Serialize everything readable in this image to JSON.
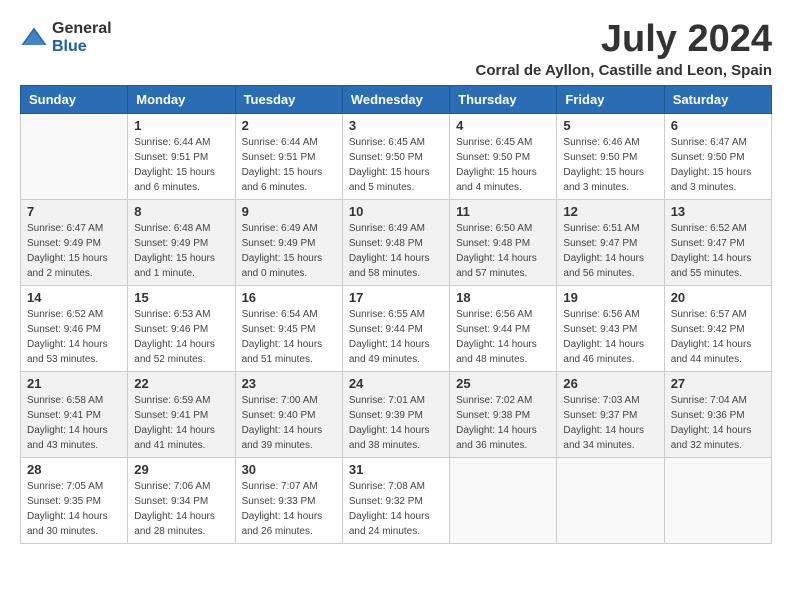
{
  "logo": {
    "general": "General",
    "blue": "Blue"
  },
  "title": {
    "month_year": "July 2024",
    "location": "Corral de Ayllon, Castille and Leon, Spain"
  },
  "headers": [
    "Sunday",
    "Monday",
    "Tuesday",
    "Wednesday",
    "Thursday",
    "Friday",
    "Saturday"
  ],
  "weeks": [
    [
      {
        "day": "",
        "info": ""
      },
      {
        "day": "1",
        "info": "Sunrise: 6:44 AM\nSunset: 9:51 PM\nDaylight: 15 hours\nand 6 minutes."
      },
      {
        "day": "2",
        "info": "Sunrise: 6:44 AM\nSunset: 9:51 PM\nDaylight: 15 hours\nand 6 minutes."
      },
      {
        "day": "3",
        "info": "Sunrise: 6:45 AM\nSunset: 9:50 PM\nDaylight: 15 hours\nand 5 minutes."
      },
      {
        "day": "4",
        "info": "Sunrise: 6:45 AM\nSunset: 9:50 PM\nDaylight: 15 hours\nand 4 minutes."
      },
      {
        "day": "5",
        "info": "Sunrise: 6:46 AM\nSunset: 9:50 PM\nDaylight: 15 hours\nand 3 minutes."
      },
      {
        "day": "6",
        "info": "Sunrise: 6:47 AM\nSunset: 9:50 PM\nDaylight: 15 hours\nand 3 minutes."
      }
    ],
    [
      {
        "day": "7",
        "info": "Sunrise: 6:47 AM\nSunset: 9:49 PM\nDaylight: 15 hours\nand 2 minutes."
      },
      {
        "day": "8",
        "info": "Sunrise: 6:48 AM\nSunset: 9:49 PM\nDaylight: 15 hours\nand 1 minute."
      },
      {
        "day": "9",
        "info": "Sunrise: 6:49 AM\nSunset: 9:49 PM\nDaylight: 15 hours\nand 0 minutes."
      },
      {
        "day": "10",
        "info": "Sunrise: 6:49 AM\nSunset: 9:48 PM\nDaylight: 14 hours\nand 58 minutes."
      },
      {
        "day": "11",
        "info": "Sunrise: 6:50 AM\nSunset: 9:48 PM\nDaylight: 14 hours\nand 57 minutes."
      },
      {
        "day": "12",
        "info": "Sunrise: 6:51 AM\nSunset: 9:47 PM\nDaylight: 14 hours\nand 56 minutes."
      },
      {
        "day": "13",
        "info": "Sunrise: 6:52 AM\nSunset: 9:47 PM\nDaylight: 14 hours\nand 55 minutes."
      }
    ],
    [
      {
        "day": "14",
        "info": "Sunrise: 6:52 AM\nSunset: 9:46 PM\nDaylight: 14 hours\nand 53 minutes."
      },
      {
        "day": "15",
        "info": "Sunrise: 6:53 AM\nSunset: 9:46 PM\nDaylight: 14 hours\nand 52 minutes."
      },
      {
        "day": "16",
        "info": "Sunrise: 6:54 AM\nSunset: 9:45 PM\nDaylight: 14 hours\nand 51 minutes."
      },
      {
        "day": "17",
        "info": "Sunrise: 6:55 AM\nSunset: 9:44 PM\nDaylight: 14 hours\nand 49 minutes."
      },
      {
        "day": "18",
        "info": "Sunrise: 6:56 AM\nSunset: 9:44 PM\nDaylight: 14 hours\nand 48 minutes."
      },
      {
        "day": "19",
        "info": "Sunrise: 6:56 AM\nSunset: 9:43 PM\nDaylight: 14 hours\nand 46 minutes."
      },
      {
        "day": "20",
        "info": "Sunrise: 6:57 AM\nSunset: 9:42 PM\nDaylight: 14 hours\nand 44 minutes."
      }
    ],
    [
      {
        "day": "21",
        "info": "Sunrise: 6:58 AM\nSunset: 9:41 PM\nDaylight: 14 hours\nand 43 minutes."
      },
      {
        "day": "22",
        "info": "Sunrise: 6:59 AM\nSunset: 9:41 PM\nDaylight: 14 hours\nand 41 minutes."
      },
      {
        "day": "23",
        "info": "Sunrise: 7:00 AM\nSunset: 9:40 PM\nDaylight: 14 hours\nand 39 minutes."
      },
      {
        "day": "24",
        "info": "Sunrise: 7:01 AM\nSunset: 9:39 PM\nDaylight: 14 hours\nand 38 minutes."
      },
      {
        "day": "25",
        "info": "Sunrise: 7:02 AM\nSunset: 9:38 PM\nDaylight: 14 hours\nand 36 minutes."
      },
      {
        "day": "26",
        "info": "Sunrise: 7:03 AM\nSunset: 9:37 PM\nDaylight: 14 hours\nand 34 minutes."
      },
      {
        "day": "27",
        "info": "Sunrise: 7:04 AM\nSunset: 9:36 PM\nDaylight: 14 hours\nand 32 minutes."
      }
    ],
    [
      {
        "day": "28",
        "info": "Sunrise: 7:05 AM\nSunset: 9:35 PM\nDaylight: 14 hours\nand 30 minutes."
      },
      {
        "day": "29",
        "info": "Sunrise: 7:06 AM\nSunset: 9:34 PM\nDaylight: 14 hours\nand 28 minutes."
      },
      {
        "day": "30",
        "info": "Sunrise: 7:07 AM\nSunset: 9:33 PM\nDaylight: 14 hours\nand 26 minutes."
      },
      {
        "day": "31",
        "info": "Sunrise: 7:08 AM\nSunset: 9:32 PM\nDaylight: 14 hours\nand 24 minutes."
      },
      {
        "day": "",
        "info": ""
      },
      {
        "day": "",
        "info": ""
      },
      {
        "day": "",
        "info": ""
      }
    ]
  ]
}
